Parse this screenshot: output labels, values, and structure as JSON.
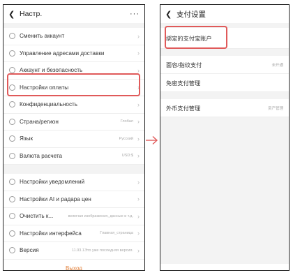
{
  "left": {
    "title": "Настр.",
    "more": "···",
    "group1": [
      {
        "label": "Сменить аккаунт",
        "value": ""
      },
      {
        "label": "Управление адресами доставки",
        "value": ""
      },
      {
        "label": "Аккаунт и безопасность",
        "value": ""
      },
      {
        "label": "Настройки оплаты",
        "value": ""
      },
      {
        "label": "Конфиденциальность",
        "value": ""
      },
      {
        "label": "Страна/регион",
        "value": "Глобал"
      },
      {
        "label": "Язык",
        "value": "Русский"
      },
      {
        "label": "Валюта расчета",
        "value": "USD:$"
      }
    ],
    "group2": [
      {
        "label": "Настройки уведомлений",
        "value": ""
      },
      {
        "label": "Настройки AI и радара цен",
        "value": ""
      },
      {
        "label": "Очистить к...",
        "value": "включая изображения, данные и т.д."
      },
      {
        "label": "Настройки интерфейса",
        "value": "Главная_страница"
      },
      {
        "label": "Версия",
        "value": "11.93.1Это уже последняя версия."
      }
    ],
    "logout": "Выход"
  },
  "right": {
    "title": "支付设置",
    "row1": "绑定的支付宝账户",
    "row2": {
      "label": "面容/指纹支付",
      "value": "未开通"
    },
    "row3": "免密支付管理",
    "row4": {
      "label": "外币支付管理",
      "value": "资产管理"
    }
  },
  "colors": {
    "highlight": "#e05a5a",
    "logout": "#e2803a"
  }
}
